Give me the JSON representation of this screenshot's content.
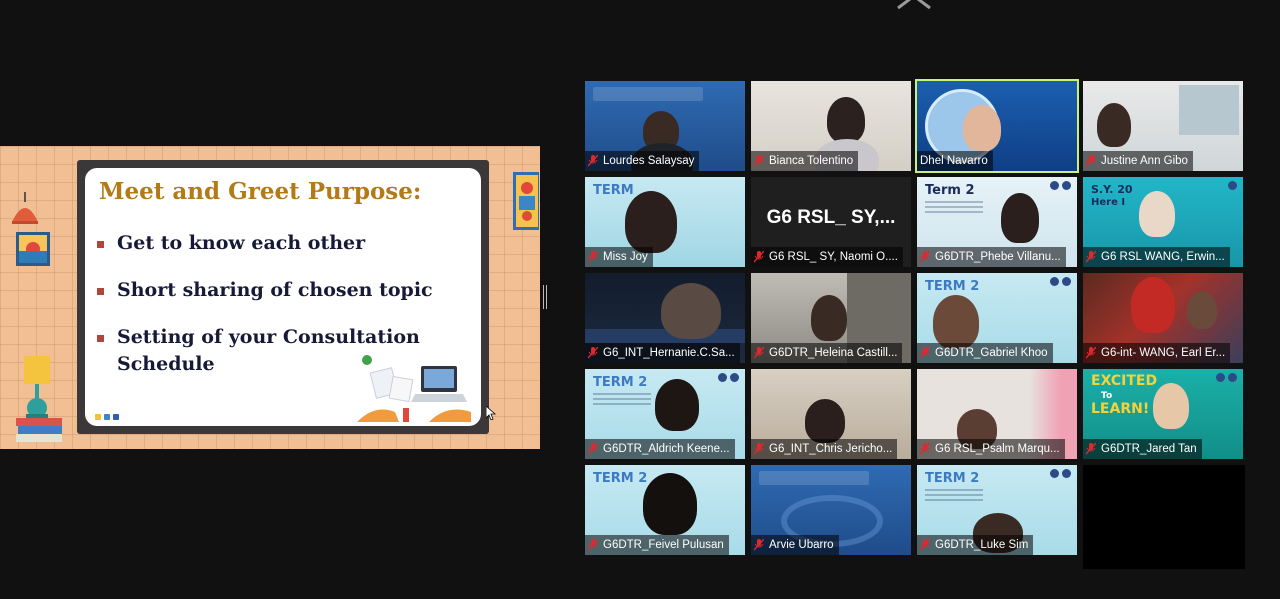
{
  "slide": {
    "title": "Meet and Greet Purpose:",
    "bullets": [
      "Get to know each other",
      "Short sharing of chosen topic",
      "Setting of your Consultation Schedule"
    ]
  },
  "participants": [
    {
      "name": "Lourdes Salaysay"
    },
    {
      "name": "Bianca Tolentino"
    },
    {
      "name": "Dhel Navarro"
    },
    {
      "name": "Justine Ann Gibo"
    },
    {
      "name": "Miss Joy",
      "term": "TERM"
    },
    {
      "name": "G6 RSL_ SY, Naomi O....",
      "big": "G6 RSL_ SY,..."
    },
    {
      "name": "G6DTR_Phebe Villanu...",
      "term": "Term 2"
    },
    {
      "name": "G6 RSL WANG, Erwin...",
      "term": "S.Y. 20",
      "term2": "Here I"
    },
    {
      "name": "G6_INT_Hernanie.C.Sa..."
    },
    {
      "name": "G6DTR_Heleina Castill..."
    },
    {
      "name": "G6DTR_Gabriel Khoo",
      "term": "TERM 2"
    },
    {
      "name": "G6-int- WANG, Earl Er..."
    },
    {
      "name": "G6DTR_Aldrich Keene...",
      "term": "TERM 2"
    },
    {
      "name": "G6_INT_Chris Jericho..."
    },
    {
      "name": "G6 RSL_Psalm Marqu..."
    },
    {
      "name": "G6DTR_Jared Tan",
      "term": "EXCITED",
      "term2": "To",
      "term3": "LEARN!"
    },
    {
      "name": "G6DTR_Feivel Pulusan",
      "term": "TERM 2"
    },
    {
      "name": "Arvie Ubarro"
    },
    {
      "name": "G6DTR_Luke Sim",
      "term": "TERM 2"
    }
  ],
  "colors": {
    "active_border": "#c9f07a",
    "mute_red": "#e0282e",
    "slide_bg": "#f2be94",
    "title_gold": "#b37a17"
  }
}
